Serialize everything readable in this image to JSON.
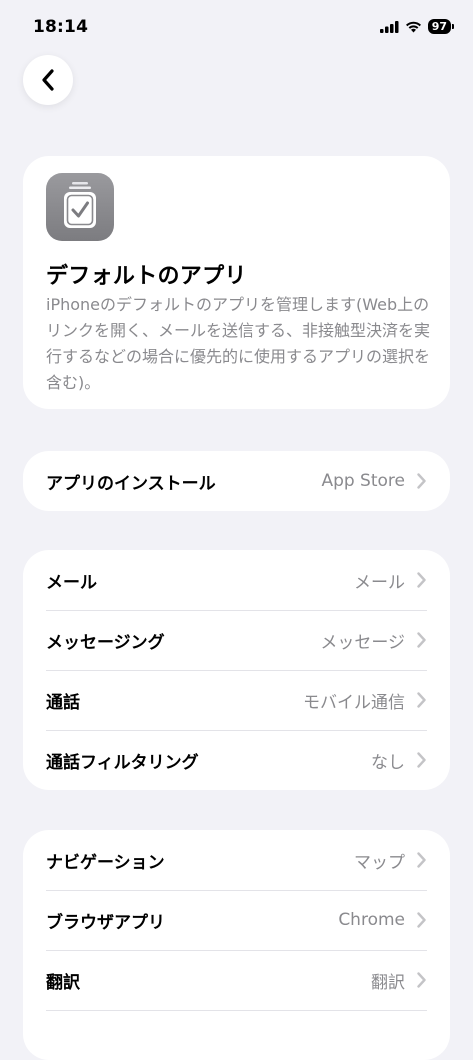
{
  "status": {
    "time": "18:14",
    "battery": "97"
  },
  "hero": {
    "title": "デフォルトのアプリ",
    "description": "iPhoneのデフォルトのアプリを管理します(Web上のリンクを開く、メールを送信する、非接触型決済を実行するなどの場合に優先的に使用するアプリの選択を含む)。"
  },
  "install": {
    "label": "アプリのインストール",
    "value": "App Store"
  },
  "communication": [
    {
      "label": "メール",
      "value": "メール"
    },
    {
      "label": "メッセージング",
      "value": "メッセージ"
    },
    {
      "label": "通話",
      "value": "モバイル通信"
    },
    {
      "label": "通話フィルタリング",
      "value": "なし"
    }
  ],
  "navigation": [
    {
      "label": "ナビゲーション",
      "value": "マップ"
    },
    {
      "label": "ブラウザアプリ",
      "value": "Chrome"
    },
    {
      "label": "翻訳",
      "value": "翻訳"
    }
  ],
  "icons": {
    "back": "chevron-left-icon",
    "row_chevron": "chevron-right-icon",
    "app": "checkmark-stack-icon",
    "signal": "cellular-signal-icon",
    "wifi": "wifi-icon",
    "battery": "battery-icon"
  },
  "colors": {
    "background": "#f2f2f7",
    "card": "#ffffff",
    "secondary_text": "#8a8a8e",
    "chevron": "#c4c4c7"
  }
}
